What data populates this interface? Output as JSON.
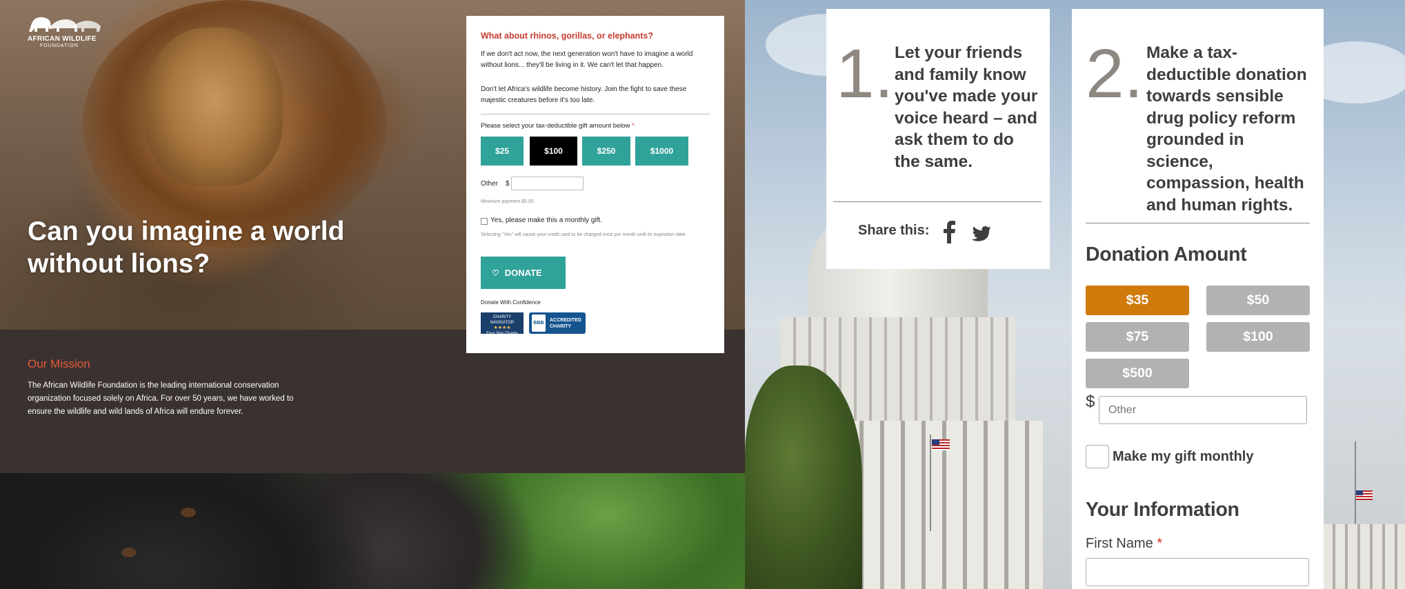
{
  "left": {
    "logo": {
      "line1": "AFRICAN WILDLIFE",
      "line2": "FOUNDATION"
    },
    "hero_title": "Can you imagine a world without lions?",
    "mission": {
      "heading": "Our Mission",
      "body": "The African Wildlife Foundation is the leading international conservation organization focused solely on Africa. For over 50 years, we have worked to ensure the wildlife and wild lands of Africa will endure forever."
    },
    "form": {
      "question": "What about rhinos, gorillas, or elephants?",
      "para1": "If we don't act now, the next generation won't have to imagine a world without lions... they'll be living in it. We can't let that happen.",
      "para2": "Don't let Africa's wildlife become history. Join the fight to save these majestic creatures before it's too late.",
      "select_label": "Please select your tax-deductible gift amount below",
      "required_mark": "*",
      "amounts": [
        "$25",
        "$100",
        "$250",
        "$1000"
      ],
      "selected_amount": "$100",
      "other_label": "Other",
      "currency": "$",
      "other_value": "",
      "min_payment": "Minimum payment $5.00.",
      "monthly_label": "Yes, please make this a monthly gift.",
      "monthly_checked": false,
      "monthly_note": "Selecting \"Yes\" will cause your credit card to be charged once per month until its expiration date.",
      "donate_label": "DONATE",
      "confidence_label": "Donate With Confidence",
      "badge1_line1": "CHARITY",
      "badge1_line2": "NAVIGATOR",
      "badge1_stars": "★★★★",
      "badge1_line3": "Four Star Charity",
      "badge2_mark": "BBB",
      "badge2_line1": "ACCREDITED",
      "badge2_line2": "CHARITY"
    }
  },
  "right": {
    "step1": {
      "number": "1.",
      "text": "Let your friends and family know you've made your voice heard – and ask them to do the same.",
      "share_label": "Share this:"
    },
    "step2": {
      "number": "2.",
      "text": "Make a tax-deductible donation towards sensible drug policy reform grounded in science, compassion, health and human rights.",
      "donation_heading": "Donation Amount",
      "amounts": [
        "$35",
        "$50",
        "$75",
        "$100",
        "$500"
      ],
      "selected_amount": "$35",
      "currency": "$",
      "other_placeholder": "Other",
      "monthly_label": "Make my gift monthly",
      "monthly_checked": false,
      "info_heading": "Your Information",
      "first_name_label": "First Name",
      "required_mark": "*",
      "first_name_value": ""
    }
  },
  "colors": {
    "teal": "#2fa299",
    "orange_selected": "#cf7a0a",
    "gray_unselected": "#b2b2b2",
    "mission_red": "#e35a3a",
    "question_red": "#c43b30"
  },
  "icons": [
    "elephant-herd-logo-icon",
    "heart-icon",
    "facebook-icon",
    "twitter-icon"
  ]
}
